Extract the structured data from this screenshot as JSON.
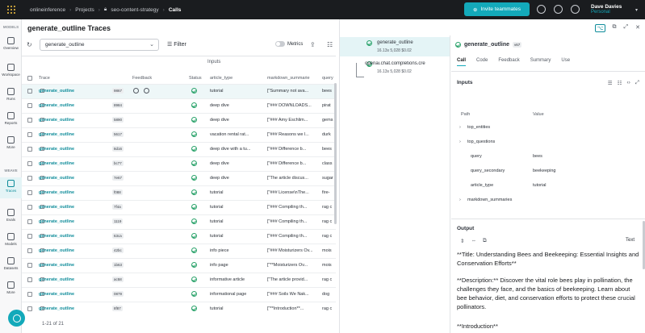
{
  "nav": {
    "crumbs": [
      "onlineinference",
      "Projects",
      "seo-content-strategy",
      "Calls"
    ],
    "invite_label": "Invite teammates",
    "user_name": "Dave Davies",
    "user_team": "Personal"
  },
  "rail": {
    "section_models": "MODELS",
    "section_weave": "WEAVE",
    "items": [
      "Overview",
      "Workspace",
      "Runs",
      "Reports",
      "More",
      "Traces",
      "Evals",
      "Models",
      "Datasets",
      "More"
    ]
  },
  "traces": {
    "title": "generate_outline Traces",
    "op_filter": "generate_outline",
    "filter_label": "Filter",
    "metrics_label": "Metrics",
    "group_header": "Inputs",
    "columns": [
      "Trace",
      "Feedback",
      "Status",
      "article_type",
      "markdown_summarie",
      "query"
    ],
    "rows": [
      {
        "op": "generate_outline",
        "hash": "9867",
        "article_type": "tutorial",
        "md": "[\"Summary not ava...",
        "query": "bees"
      },
      {
        "op": "generate_outline",
        "hash": "8984",
        "article_type": "deep dive",
        "md": "[\"### DOWNLOADS...",
        "query": "pirat"
      },
      {
        "op": "generate_outline",
        "hash": "5890",
        "article_type": "deep dive",
        "md": "[\"### Amy Eschlim...",
        "query": "gems"
      },
      {
        "op": "generate_outline",
        "hash": "5617",
        "article_type": "vacation rental rat...",
        "md": "[\"### Reasons we l...",
        "query": "durk"
      },
      {
        "op": "generate_outline",
        "hash": "8d16",
        "article_type": "deep dive with a tu...",
        "md": "[\"### Difference b...",
        "query": "bees"
      },
      {
        "op": "generate_outline",
        "hash": "bc77",
        "article_type": "deep dive",
        "md": "[\"### Difference b...",
        "query": "class"
      },
      {
        "op": "generate_outline",
        "hash": "7e67",
        "article_type": "deep dive",
        "md": "[\"The article discus...",
        "query": "sugar"
      },
      {
        "op": "generate_outline",
        "hash": "f088",
        "article_type": "tutorial",
        "md": "[\"### License\\nThe...",
        "query": "fire-"
      },
      {
        "op": "generate_outline",
        "hash": "7f4a",
        "article_type": "tutorial",
        "md": "[\"### Compiling th...",
        "query": "rag c"
      },
      {
        "op": "generate_outline",
        "hash": "1119",
        "article_type": "tutorial",
        "md": "[\"### Compiling th...",
        "query": "rag c"
      },
      {
        "op": "generate_outline",
        "hash": "63ca",
        "article_type": "tutorial",
        "md": "[\"### Compiling th...",
        "query": "rag c"
      },
      {
        "op": "generate_outline",
        "hash": "42bc",
        "article_type": "info piece",
        "md": "[\"### Moisturizers Ov...",
        "query": "mois"
      },
      {
        "op": "generate_outline",
        "hash": "1b63",
        "article_type": "info page",
        "md": "[\"**Moisturizers Ov...",
        "query": "mois"
      },
      {
        "op": "generate_outline",
        "hash": "ac58",
        "article_type": "informative article",
        "md": "[\"The article provid...",
        "query": "rag c"
      },
      {
        "op": "generate_outline",
        "hash": "0879",
        "article_type": "informational page",
        "md": "[\"### Soils We Nak...",
        "query": "dog"
      },
      {
        "op": "generate_outline",
        "hash": "8f87",
        "article_type": "tutorial",
        "md": "[\"**Introduction**...",
        "query": "rag c"
      }
    ],
    "pager": "1-21 of 21"
  },
  "panel": {
    "tree": [
      {
        "name": "generate_outline",
        "meta": [
          "16.13s",
          "5,028",
          "$0.02"
        ]
      },
      {
        "name": "openai.chat.completions.cre",
        "meta": [
          "16.13s",
          "5,028",
          "$0.02"
        ]
      }
    ],
    "detail_title": "generate_outline",
    "detail_version": "v67",
    "tabs": [
      "Call",
      "Code",
      "Feedback",
      "Summary",
      "Use"
    ],
    "inputs_title": "Inputs",
    "kv_headers": [
      "Path",
      "Value"
    ],
    "kv": [
      {
        "path": "top_entities",
        "value": "",
        "expandable": true
      },
      {
        "path": "top_questions",
        "value": "",
        "expandable": true
      },
      {
        "path": "query",
        "value": "bees",
        "expandable": false
      },
      {
        "path": "query_secondary",
        "value": "beekeeping",
        "expandable": false
      },
      {
        "path": "article_type",
        "value": "tutorial",
        "expandable": false
      },
      {
        "path": "markdown_summaries",
        "value": "",
        "expandable": true
      }
    ],
    "output_title": "Output",
    "output_mode": "Text",
    "output_paragraphs": [
      "**Title: Understanding Bees and Beekeeping: Essential Insights and Conservation Efforts**",
      "**Description:** Discover the vital role bees play in pollination, the challenges they face, and the basics of beekeeping. Learn about bee behavior, diet, and conservation efforts to protect these crucial pollinators.",
      "**Introduction**"
    ]
  }
}
